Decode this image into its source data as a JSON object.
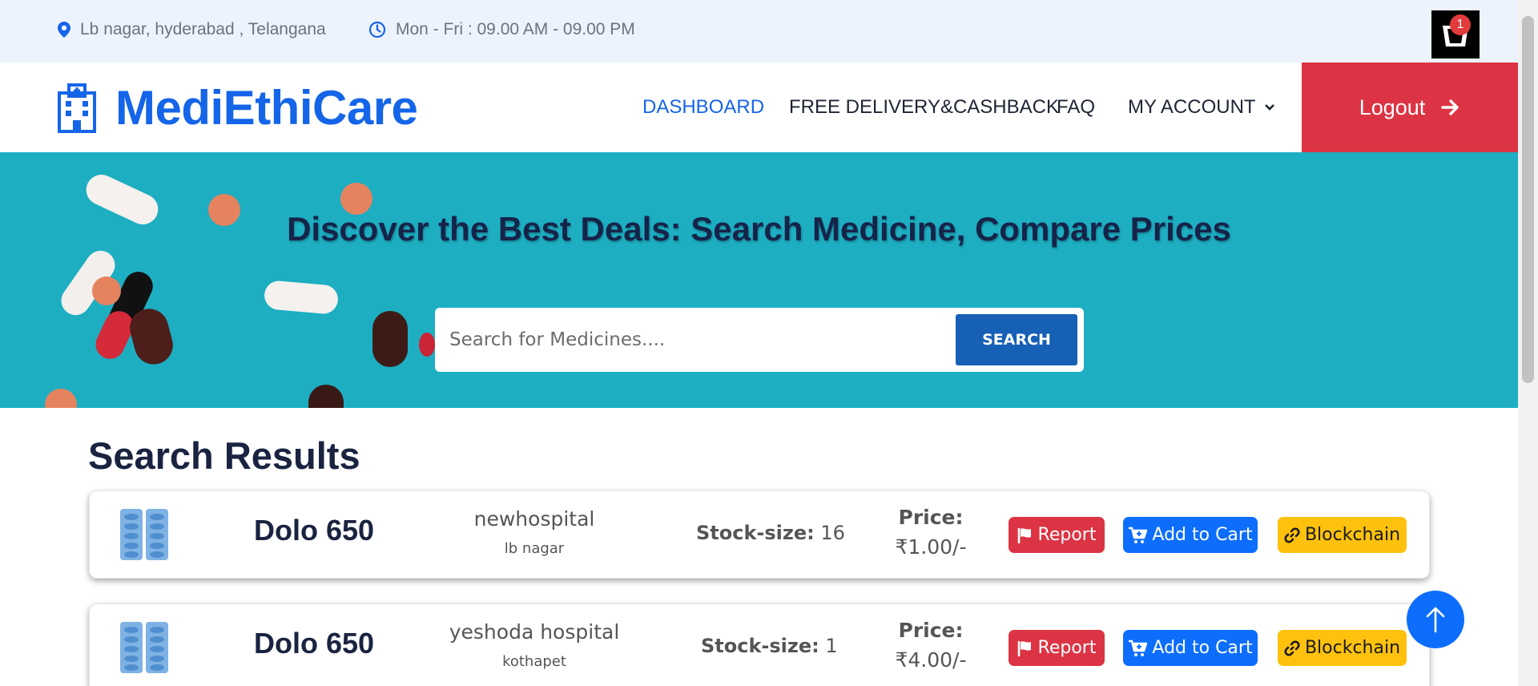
{
  "topbar": {
    "location": "Lb nagar, hyderabad , Telangana",
    "hours": "Mon - Fri : 09.00 AM - 09.00 PM",
    "cart_count": "1"
  },
  "navbar": {
    "brand": "MediEthiCare",
    "links": [
      "DASHBOARD",
      "FREE DELIVERY&CASHBACK",
      "FAQ",
      "MY ACCOUNT"
    ],
    "logout": "Logout"
  },
  "hero": {
    "title": "Discover the Best Deals: Search Medicine, Compare Prices",
    "search_placeholder": "Search for Medicines....",
    "search_button": "SEARCH"
  },
  "results": {
    "title": "Search Results",
    "items": [
      {
        "name": "Dolo 650",
        "hospital": "newhospital",
        "location": "lb nagar",
        "stock_label": "Stock-size:",
        "stock": "16",
        "price_label": "Price:",
        "price": "₹1.00/-",
        "report": "Report",
        "add_to_cart": "Add to Cart",
        "blockchain": "Blockchain"
      },
      {
        "name": "Dolo 650",
        "hospital": "yeshoda hospital",
        "location": "kothapet",
        "stock_label": "Stock-size:",
        "stock": "1",
        "price_label": "Price:",
        "price": "₹4.00/-",
        "report": "Report",
        "add_to_cart": "Add to Cart",
        "blockchain": "Blockchain"
      }
    ]
  },
  "colors": {
    "brand": "#1565e8",
    "logout": "#dc3444",
    "hero": "#1daec2",
    "search_button": "#1660b5",
    "report": "#dc3444",
    "cart": "#0d6efd",
    "blockchain": "#fdc10e"
  },
  "icons": [
    "location-pin-icon",
    "clock-icon",
    "cart-icon",
    "hospital-icon",
    "chevron-down-icon",
    "arrow-right-icon",
    "medicine-strip-icon",
    "flag-icon",
    "cart-plus-icon",
    "link-icon",
    "arrow-up-icon"
  ]
}
